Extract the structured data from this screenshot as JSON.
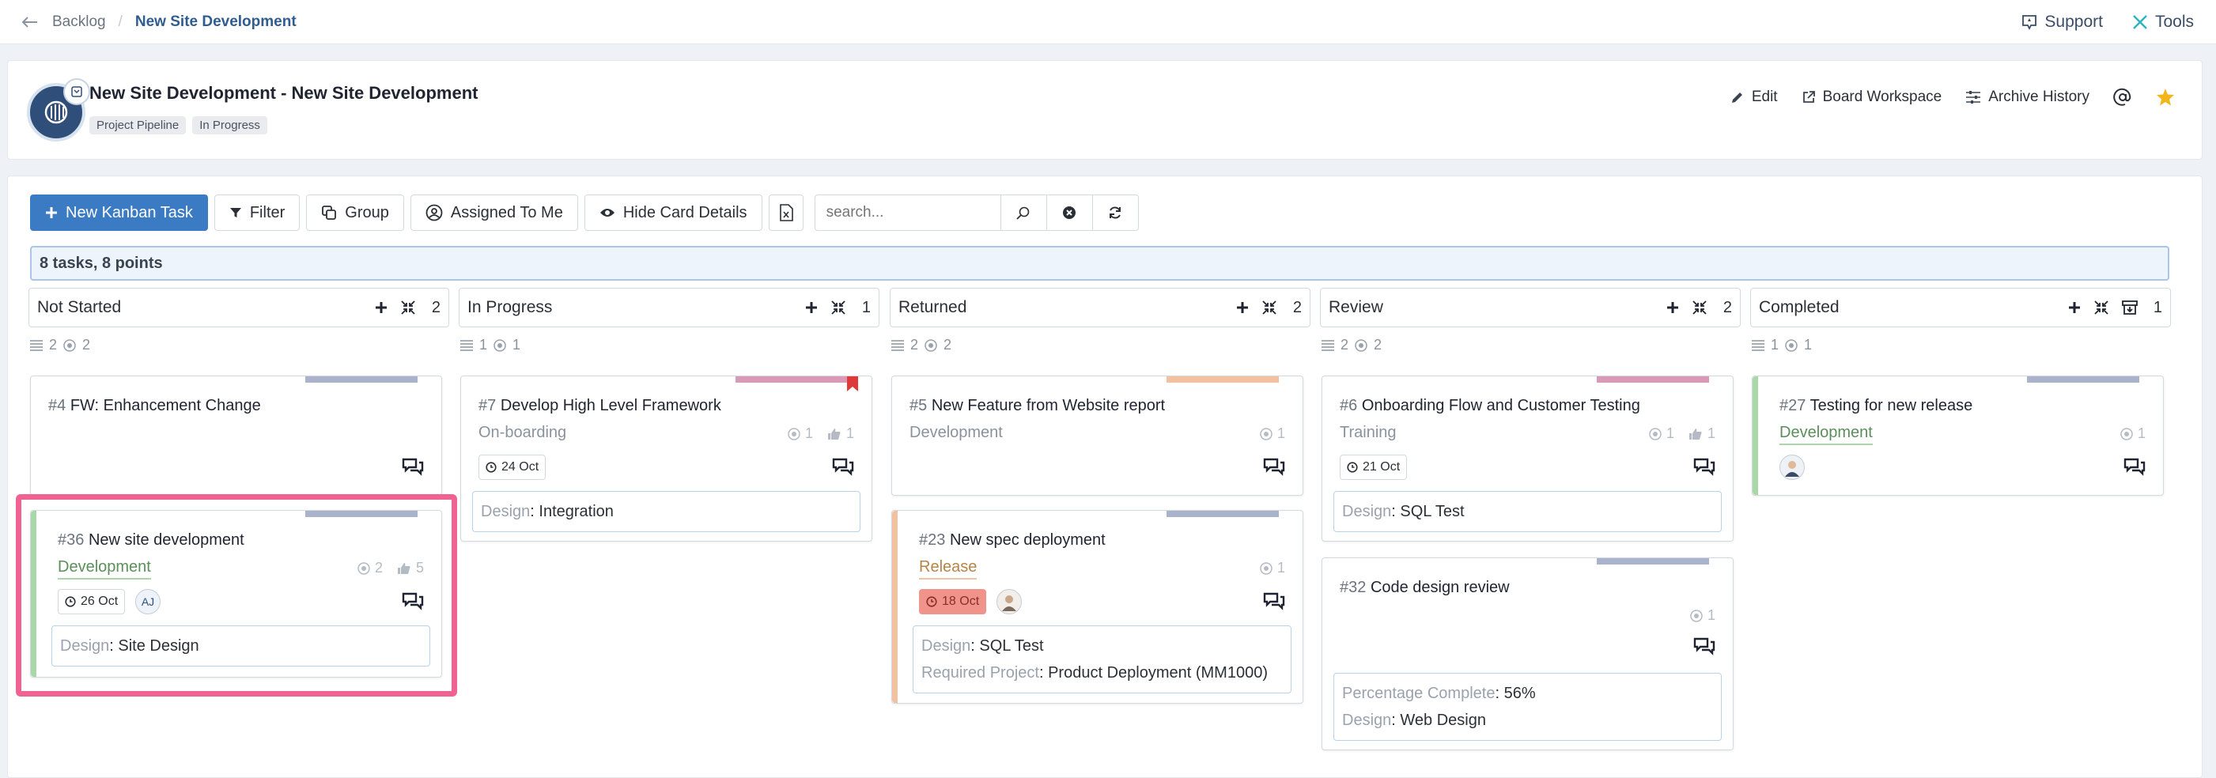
{
  "topbar": {
    "back": "Backlog",
    "current": "New Site Development",
    "support": "Support",
    "tools": "Tools"
  },
  "header": {
    "title": "New Site Development - New Site Development",
    "tags": [
      "Project Pipeline",
      "In Progress"
    ],
    "actions": {
      "edit": "Edit",
      "workspace": "Board Workspace",
      "archive": "Archive History"
    }
  },
  "toolbar": {
    "new_task": "New Kanban Task",
    "filter": "Filter",
    "group": "Group",
    "assigned": "Assigned To Me",
    "hide": "Hide Card Details",
    "search_placeholder": "search..."
  },
  "summary": "8 tasks, 8 points",
  "columns": [
    {
      "name": "Not Started",
      "count": "2",
      "stat_a": "2",
      "stat_b": "2"
    },
    {
      "name": "In Progress",
      "count": "1",
      "stat_a": "1",
      "stat_b": "1"
    },
    {
      "name": "Returned",
      "count": "2",
      "stat_a": "2",
      "stat_b": "2"
    },
    {
      "name": "Review",
      "count": "2",
      "stat_a": "2",
      "stat_b": "2"
    },
    {
      "name": "Completed",
      "count": "1",
      "stat_a": "1",
      "stat_b": "1"
    }
  ],
  "cards": {
    "c4": {
      "num": "#4",
      "title": "FW: Enhancement Change"
    },
    "c36": {
      "num": "#36",
      "title": "New site development",
      "sub": "Development",
      "points": "2",
      "likes": "5",
      "date": "26 Oct",
      "assignee": "AJ",
      "d_key": "Design",
      "d_val": "Site Design"
    },
    "c7": {
      "num": "#7",
      "title": "Develop High Level Framework",
      "sub": "On-boarding",
      "points": "1",
      "likes": "1",
      "date": "24 Oct",
      "d_key": "Design",
      "d_val": "Integration"
    },
    "c5": {
      "num": "#5",
      "title": "New Feature from Website report",
      "sub": "Development",
      "points": "1"
    },
    "c23": {
      "num": "#23",
      "title": "New spec deployment",
      "sub": "Release",
      "points": "1",
      "date": "18 Oct",
      "d_key": "Design",
      "d_val": "SQL Test",
      "d2_key": "Required Project",
      "d2_val": "Product Deployment (MM1000)"
    },
    "c6": {
      "num": "#6",
      "title": "Onboarding Flow and Customer Testing",
      "sub": "Training",
      "points": "1",
      "likes": "1",
      "date": "21 Oct",
      "d_key": "Design",
      "d_val": "SQL Test"
    },
    "c32": {
      "num": "#32",
      "title": "Code design review",
      "points": "1",
      "d_key": "Percentage Complete",
      "d_val": "56%",
      "d2_key": "Design",
      "d2_val": "Web Design"
    },
    "c27": {
      "num": "#27",
      "title": "Testing for new release",
      "sub": "Development",
      "points": "1"
    }
  },
  "colors": {
    "accent": "#3b7bc4",
    "highlight": "#f06292",
    "bar_blue": "#a9b3cc",
    "bar_pink": "#d99ab8",
    "bar_orange": "#f2c1a0",
    "green": "#a8d8a8"
  }
}
